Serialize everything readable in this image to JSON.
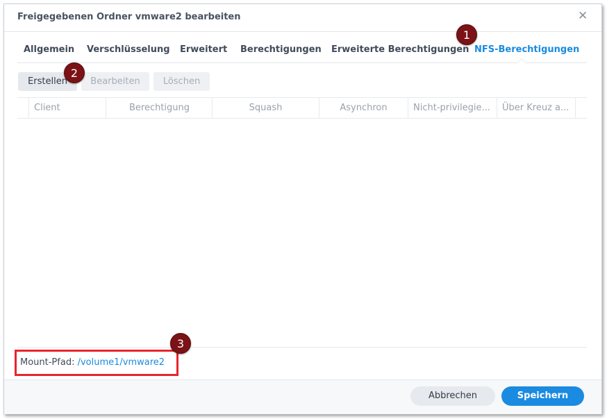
{
  "dialog": {
    "title": "Freigegebenen Ordner vmware2 bearbeiten",
    "close_icon": "close-icon"
  },
  "tabs": [
    {
      "label": "Allgemein",
      "active": false
    },
    {
      "label": "Verschlüsselung",
      "active": false
    },
    {
      "label": "Erweitert",
      "active": false
    },
    {
      "label": "Berechtigungen",
      "active": false
    },
    {
      "label": "Erweiterte Berechtigungen",
      "active": false
    },
    {
      "label": "NFS-Berechtigungen",
      "active": true
    }
  ],
  "toolbar": {
    "create_label": "Erstellen",
    "edit_label": "Bearbeiten",
    "delete_label": "Löschen"
  },
  "table": {
    "columns": [
      "Client",
      "Berechtigung",
      "Squash",
      "Asynchron",
      "Nicht-privilegie...",
      "Über Kreuz a..."
    ],
    "rows": []
  },
  "mount": {
    "label": "Mount-Pfad:",
    "path": "/volume1/vmware2"
  },
  "footer": {
    "cancel_label": "Abbrechen",
    "save_label": "Speichern"
  },
  "markers": [
    "1",
    "2",
    "3"
  ],
  "colors": {
    "accent": "#1a8be0",
    "highlight_box": "#e8252b",
    "marker": "#7a1216"
  }
}
